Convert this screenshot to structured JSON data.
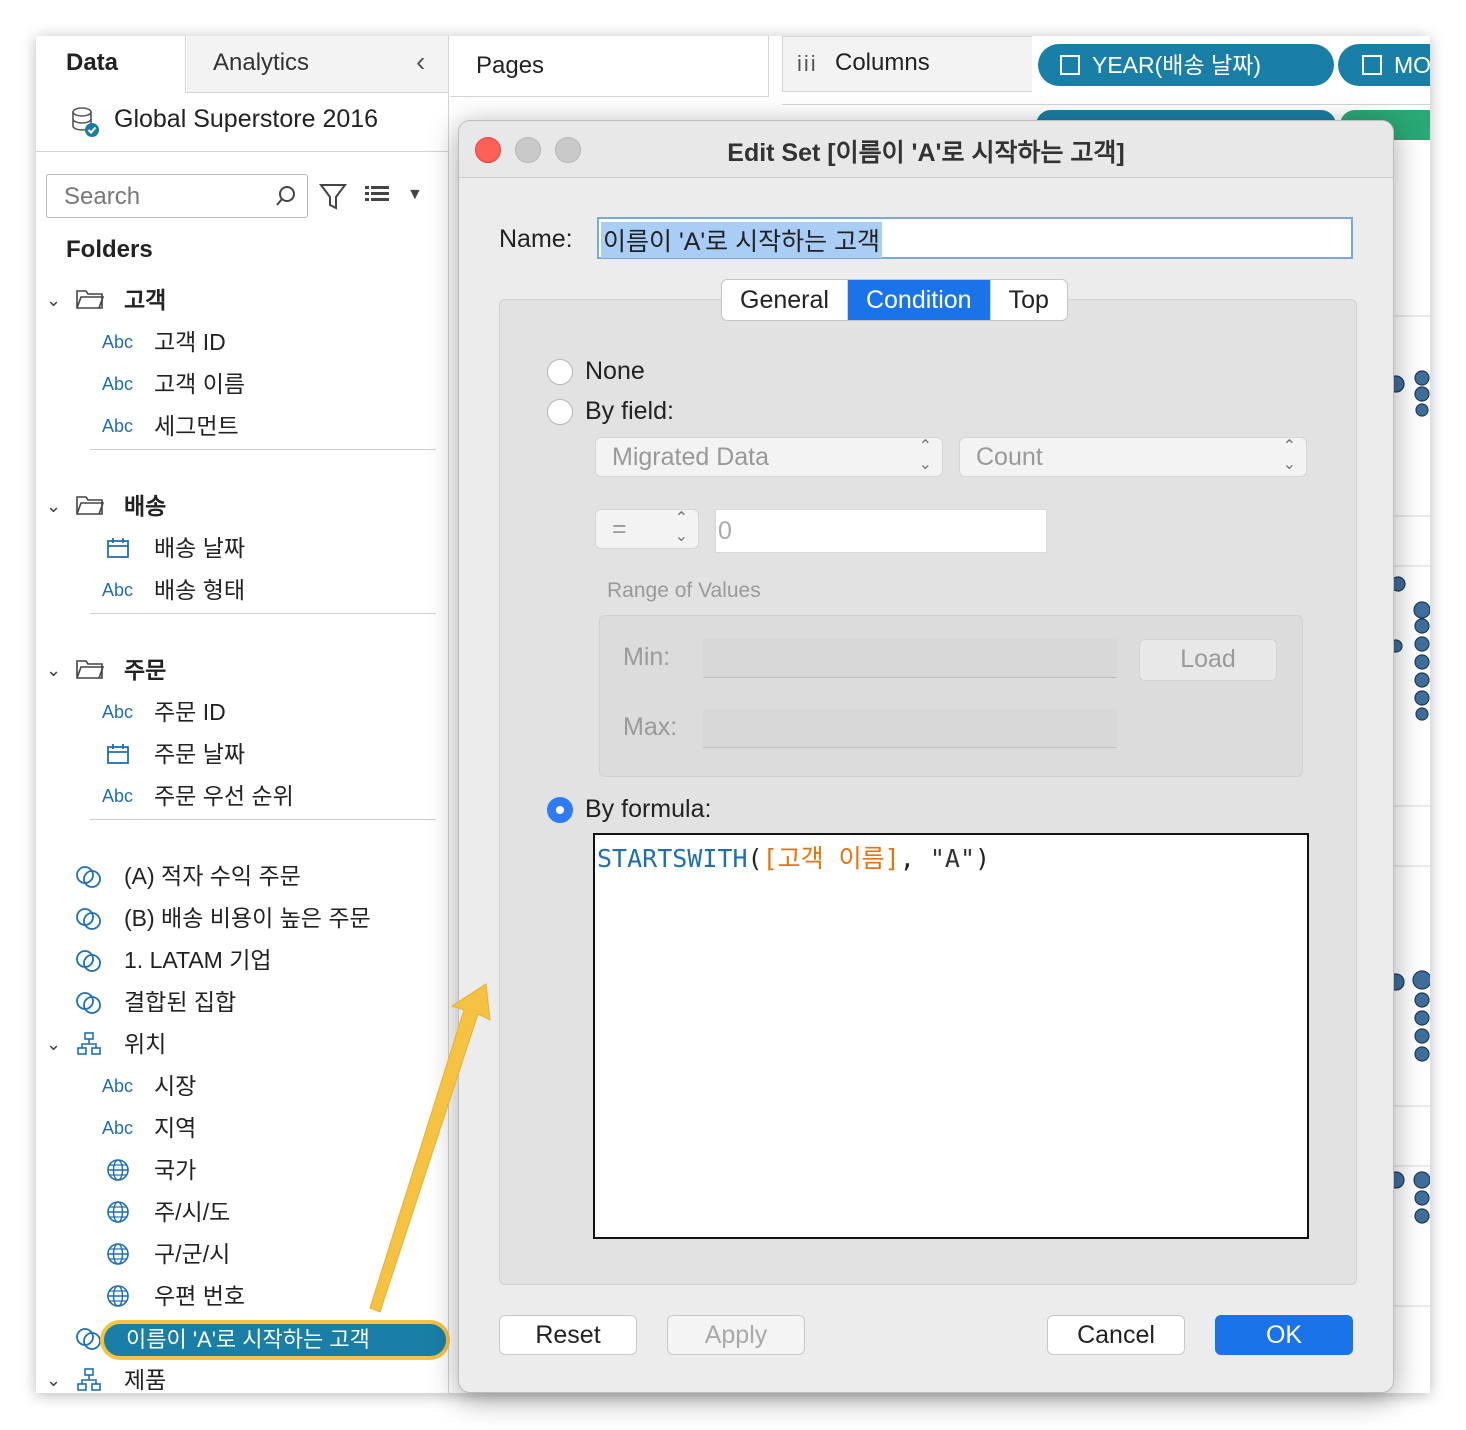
{
  "data_pane": {
    "tab_data": "Data",
    "tab_analytics": "Analytics",
    "datasource": "Global Superstore 2016",
    "search_placeholder": "Search",
    "folders_heading": "Folders",
    "folders": [
      {
        "name": "고객",
        "fields": [
          {
            "type": "Abc",
            "name": "고객 ID"
          },
          {
            "type": "Abc",
            "name": "고객 이름"
          },
          {
            "type": "Abc",
            "name": "세그먼트"
          }
        ]
      },
      {
        "name": "배송",
        "fields": [
          {
            "type": "date",
            "name": "배송 날짜"
          },
          {
            "type": "Abc",
            "name": "배송 형태"
          }
        ]
      },
      {
        "name": "주문",
        "fields": [
          {
            "type": "Abc",
            "name": "주문 ID"
          },
          {
            "type": "date",
            "name": "주문 날짜"
          },
          {
            "type": "Abc",
            "name": "주문 우선 순위"
          }
        ]
      }
    ],
    "sets": [
      "(A) 적자 수익 주문",
      "(B) 배송 비용이 높은 주문",
      "1. LATAM 기업",
      "결합된 집합"
    ],
    "hierarchy_location": {
      "name": "위치",
      "fields": [
        {
          "type": "Abc",
          "name": "시장"
        },
        {
          "type": "Abc",
          "name": "지역"
        },
        {
          "type": "geo",
          "name": "국가"
        },
        {
          "type": "geo",
          "name": "주/시/도"
        },
        {
          "type": "geo",
          "name": "구/군/시"
        },
        {
          "type": "geo",
          "name": "우편 번호"
        }
      ]
    },
    "highlighted_set": "이름이 'A'로 시작하는 고객",
    "hierarchy_product": "제품",
    "abc_label": "Abc"
  },
  "shelves": {
    "pages": "Pages",
    "columns": "Columns",
    "pill_year": "YEAR(배송 날짜)",
    "pill_month": "MO"
  },
  "dialog": {
    "title": "Edit Set [이름이 'A'로 시작하는 고객]",
    "name_label": "Name:",
    "name_value": "이름이 'A'로 시작하는 고객",
    "tabs": [
      "General",
      "Condition",
      "Top"
    ],
    "active_tab": "Condition",
    "radio_none": "None",
    "radio_by_field": "By field:",
    "field_select": "Migrated Data",
    "agg_select": "Count",
    "operator": "=",
    "value": "0",
    "range_label": "Range of Values",
    "min_label": "Min:",
    "max_label": "Max:",
    "load_button": "Load",
    "radio_by_formula": "By formula:",
    "formula": {
      "fn": "STARTSWITH",
      "open": "(",
      "field": "[고객 이름]",
      "comma": ",",
      "str": "\"A\"",
      "close": ")"
    },
    "buttons": {
      "reset": "Reset",
      "apply": "Apply",
      "cancel": "Cancel",
      "ok": "OK"
    }
  },
  "colors": {
    "accent": "#1a73e8",
    "pill": "#1a7fa6",
    "highlight_border": "#f5c242",
    "formula_fn": "#1f6fb2",
    "formula_field": "#e8720c"
  }
}
